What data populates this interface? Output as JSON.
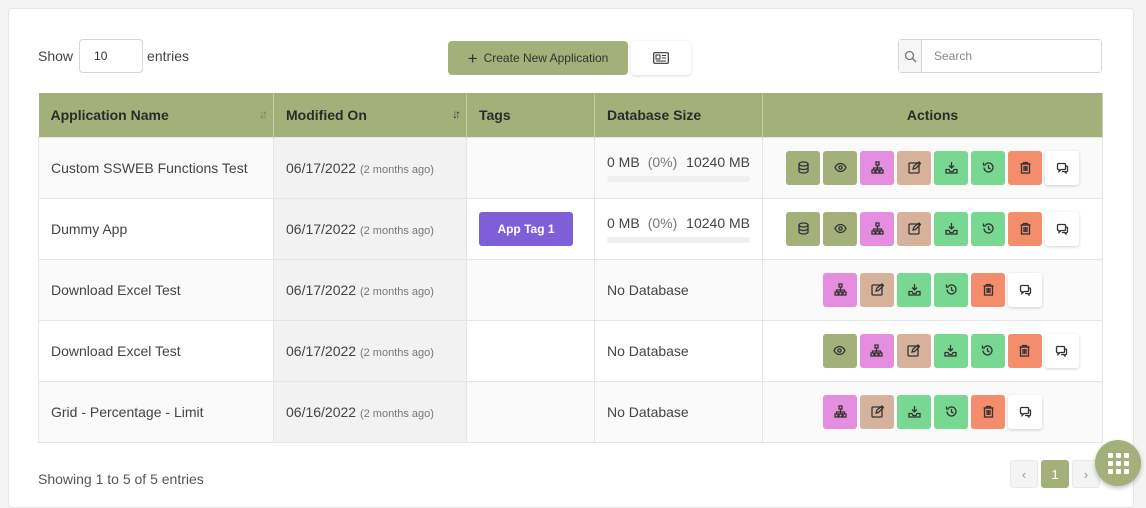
{
  "controls": {
    "show_label": "Show",
    "entries_value": "10",
    "entries_label": "entries",
    "create_label": "Create New Application",
    "search_placeholder": "Search"
  },
  "table": {
    "headers": [
      "Application Name",
      "Modified On",
      "Tags",
      "Database Size",
      "Actions"
    ],
    "rows": [
      {
        "name": "Custom SSWEB Functions Test",
        "date": "06/17/2022",
        "ago": "(2 months ago)",
        "tag": "",
        "db_used": "0 MB",
        "db_pct": "(0%)",
        "db_max": "10240 MB",
        "db_usage_fraction": 0
      },
      {
        "name": "Dummy App",
        "date": "06/17/2022",
        "ago": "(2 months ago)",
        "tag": "App Tag 1",
        "db_used": "0 MB",
        "db_pct": "(0%)",
        "db_max": "10240 MB",
        "db_usage_fraction": 0
      },
      {
        "name": "Download Excel Test",
        "date": "06/17/2022",
        "ago": "(2 months ago)",
        "tag": "",
        "db_text": "No Database"
      },
      {
        "name": "Download Excel Test",
        "date": "06/17/2022",
        "ago": "(2 months ago)",
        "tag": "",
        "db_text": "No Database"
      },
      {
        "name": "Grid - Percentage - Limit",
        "date": "06/16/2022",
        "ago": "(2 months ago)",
        "tag": "",
        "db_text": "No Database"
      }
    ]
  },
  "footer": {
    "info": "Showing 1 to 5 of 5 entries",
    "prev": "‹",
    "page": "1",
    "next": "›"
  },
  "colors": {
    "accent": "#a3b07a",
    "tag": "#7f5fd8",
    "pink": "#e58ee0",
    "tan": "#d7b29b",
    "green": "#78d891",
    "red": "#f48d6c"
  },
  "icons": [
    "database-icon",
    "eye-icon",
    "sitemap-icon",
    "edit-icon",
    "download-icon",
    "history-icon",
    "trash-icon",
    "comment-icon"
  ]
}
